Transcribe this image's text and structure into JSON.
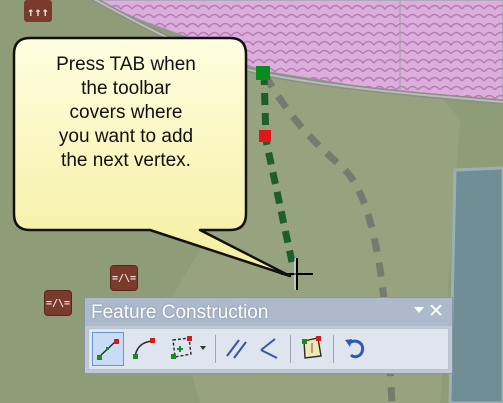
{
  "callout": {
    "lines": [
      "Press TAB when",
      "the toolbar",
      "covers where",
      "you want to add",
      "the next vertex."
    ]
  },
  "map": {
    "symbol_glyph": "=/\\="
  },
  "toolbar": {
    "title": "Feature Construction",
    "close_glyph": "✕",
    "tools": [
      {
        "name": "straight-segment-tool",
        "active": true
      },
      {
        "name": "curve-segment-tool",
        "active": false
      },
      {
        "name": "trace-tool",
        "active": false
      },
      {
        "name": "parallel-tool",
        "active": false
      },
      {
        "name": "perpendicular-tool",
        "active": false
      },
      {
        "name": "finish-sketch-tool",
        "active": false
      },
      {
        "name": "undo-tool",
        "active": false
      }
    ]
  },
  "colors": {
    "map_green": "#8f9c78",
    "pink_area": "#d9a8d6",
    "road": "#8a8a7a",
    "sketch_line": "#1d5e2c",
    "vertex_green": "#0b8a1d",
    "vertex_red": "#e01818",
    "water": "#6e8f96",
    "callout_fill": "#fbf8c9",
    "toolbar_bg": "#dfe5ee",
    "toolbar_title": "#adbacb",
    "symbol": "#7a3a2c"
  }
}
